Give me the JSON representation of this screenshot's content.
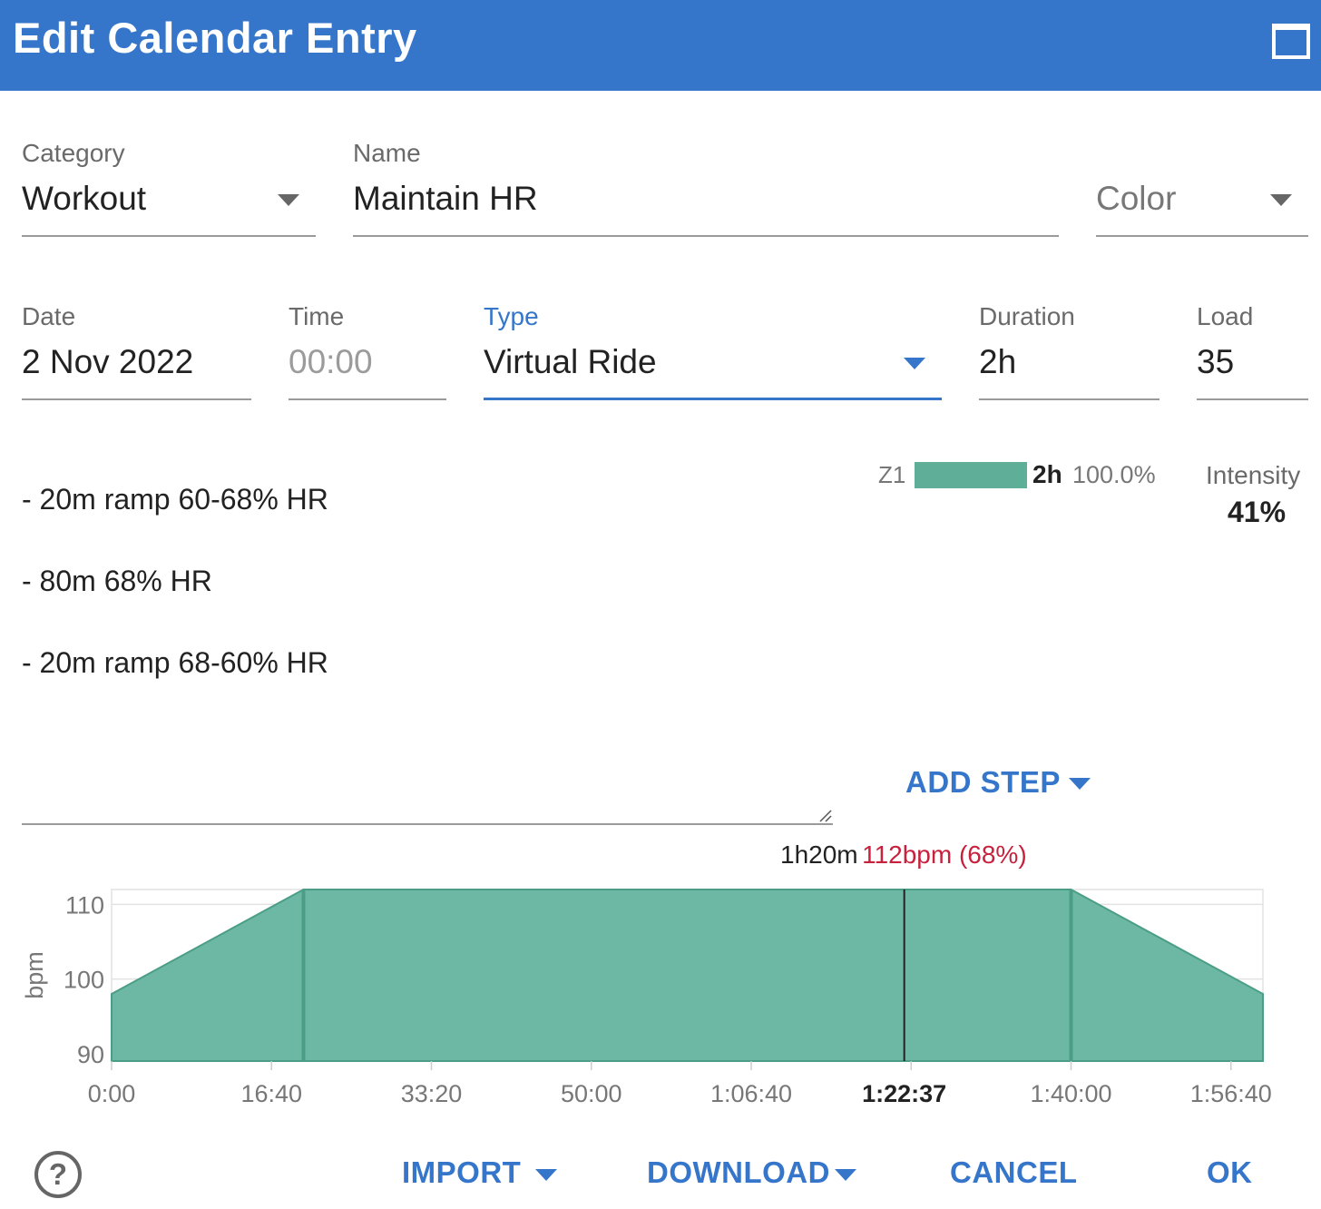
{
  "dialog": {
    "title": "Edit Calendar Entry"
  },
  "form": {
    "category": {
      "label": "Category",
      "value": "Workout"
    },
    "name": {
      "label": "Name",
      "value": "Maintain HR"
    },
    "color": {
      "placeholder": "Color"
    },
    "date": {
      "label": "Date",
      "value": "2 Nov 2022"
    },
    "time": {
      "label": "Time",
      "value": "00:00"
    },
    "type": {
      "label": "Type",
      "value": "Virtual Ride"
    },
    "duration": {
      "label": "Duration",
      "value": "2h"
    },
    "load": {
      "label": "Load",
      "value": "35"
    }
  },
  "description": {
    "lines": [
      "- 20m ramp 60-68% HR",
      "- 80m 68% HR",
      "- 20m ramp 68-60% HR"
    ]
  },
  "zones": {
    "items": [
      {
        "name": "Z1",
        "duration": "2h",
        "percent": "100.0%",
        "fraction": 1.0
      }
    ]
  },
  "intensity": {
    "label": "Intensity",
    "value": "41%"
  },
  "add_step": {
    "label": "ADD STEP"
  },
  "tooltip": {
    "time": "1h20m",
    "hr": "112bpm (68%)"
  },
  "chart_data": {
    "type": "area",
    "ylabel": "bpm",
    "ylim": [
      89,
      112
    ],
    "yticks": [
      90,
      100,
      110
    ],
    "xlim": [
      0,
      7200
    ],
    "xticks": [
      0,
      1000,
      2000,
      3000,
      4000,
      5000,
      6000,
      7000
    ],
    "xtick_labels": [
      "0:00",
      "16:40",
      "33:20",
      "50:00",
      "1:06:40",
      "1:22:37",
      "1:40:00",
      "1:56:40"
    ],
    "highlight_tick": {
      "x": 4957,
      "label": "1:22:37"
    },
    "cursor_x": 4957,
    "fill_color": "#6cb8a5",
    "line_color": "#4b9e85",
    "points": [
      {
        "x": 0,
        "y": 98
      },
      {
        "x": 1200,
        "y": 112
      },
      {
        "x": 6000,
        "y": 112
      },
      {
        "x": 7200,
        "y": 98
      }
    ],
    "step_boundaries": [
      1200,
      6000
    ],
    "grid": true
  },
  "footer": {
    "import_label": "IMPORT",
    "download_label": "DOWNLOAD",
    "cancel_label": "CANCEL",
    "ok_label": "OK",
    "help_symbol": "?"
  }
}
